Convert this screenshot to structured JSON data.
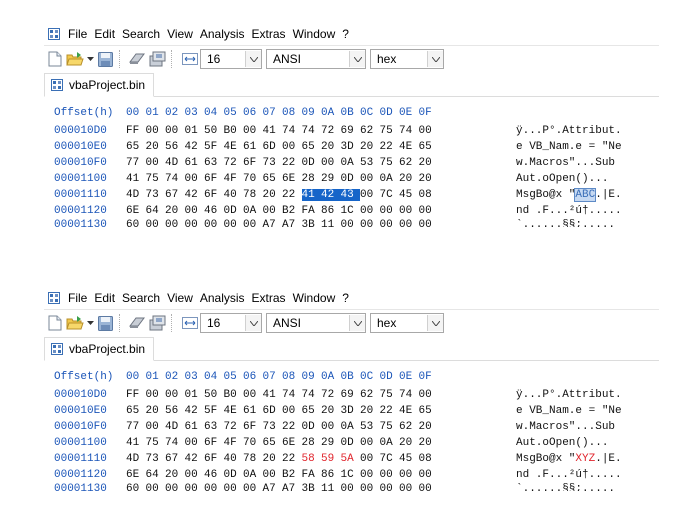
{
  "menu": [
    "File",
    "Edit",
    "Search",
    "View",
    "Analysis",
    "Extras",
    "Window",
    "?"
  ],
  "toolbar": {
    "bytes_per_row": "16",
    "encoding": "ANSI",
    "display_mode": "hex"
  },
  "tab": {
    "label": "vbaProject.bin"
  },
  "hex_header": {
    "offset_label": "Offset(h)",
    "columns": [
      "00",
      "01",
      "02",
      "03",
      "04",
      "05",
      "06",
      "07",
      "08",
      "09",
      "0A",
      "0B",
      "0C",
      "0D",
      "0E",
      "0F"
    ]
  },
  "panels": [
    {
      "rows": [
        {
          "offset": "000010D0",
          "bytes": [
            "FF",
            "00",
            "00",
            "01",
            "50",
            "B0",
            "00",
            "41",
            "74",
            "74",
            "72",
            "69",
            "62",
            "75",
            "74",
            "00"
          ],
          "ascii": "ÿ...P°.Attribut."
        },
        {
          "offset": "000010E0",
          "bytes": [
            "65",
            "20",
            "56",
            "42",
            "5F",
            "4E",
            "61",
            "6D",
            "00",
            "65",
            "20",
            "3D",
            "20",
            "22",
            "4E",
            "65"
          ],
          "ascii": "e VB_Nam.e = \"Ne"
        },
        {
          "offset": "000010F0",
          "bytes": [
            "77",
            "00",
            "4D",
            "61",
            "63",
            "72",
            "6F",
            "73",
            "22",
            "0D",
            "00",
            "0A",
            "53",
            "75",
            "62",
            "20"
          ],
          "ascii": "w.Macros\"...Sub "
        },
        {
          "offset": "00001100",
          "bytes": [
            "41",
            "75",
            "74",
            "00",
            "6F",
            "4F",
            "70",
            "65",
            "6E",
            "28",
            "29",
            "0D",
            "00",
            "0A",
            "20",
            "20"
          ],
          "ascii": "Aut.oOpen()...  "
        },
        {
          "offset": "00001110",
          "bytes": [
            "4D",
            "73",
            "67",
            "42",
            "6F",
            "40",
            "78",
            "20",
            "22",
            "41",
            "42",
            "43",
            "00",
            "7C",
            "45",
            "08"
          ],
          "ascii_pre": "MsgBo@x \"",
          "ascii_mark": "ABC",
          "ascii_post": ".|E."
        },
        {
          "offset": "00001120",
          "bytes": [
            "6E",
            "64",
            "20",
            "00",
            "46",
            "0D",
            "0A",
            "00",
            "B2",
            "FA",
            "86",
            "1C",
            "00",
            "00",
            "00",
            "00"
          ],
          "ascii": "nd .F...²ú†....."
        },
        {
          "offset": "00001130",
          "bytes": [
            "60",
            "00",
            "00",
            "00",
            "00",
            "00",
            "00",
            "A7",
            "A7",
            "3B",
            "11",
            "00",
            "00",
            "00",
            "00",
            "00"
          ],
          "ascii": "`......§§;....."
        }
      ]
    },
    {
      "rows": [
        {
          "offset": "000010D0",
          "bytes": [
            "FF",
            "00",
            "00",
            "01",
            "50",
            "B0",
            "00",
            "41",
            "74",
            "74",
            "72",
            "69",
            "62",
            "75",
            "74",
            "00"
          ],
          "ascii": "ÿ...P°.Attribut."
        },
        {
          "offset": "000010E0",
          "bytes": [
            "65",
            "20",
            "56",
            "42",
            "5F",
            "4E",
            "61",
            "6D",
            "00",
            "65",
            "20",
            "3D",
            "20",
            "22",
            "4E",
            "65"
          ],
          "ascii": "e VB_Nam.e = \"Ne"
        },
        {
          "offset": "000010F0",
          "bytes": [
            "77",
            "00",
            "4D",
            "61",
            "63",
            "72",
            "6F",
            "73",
            "22",
            "0D",
            "00",
            "0A",
            "53",
            "75",
            "62",
            "20"
          ],
          "ascii": "w.Macros\"...Sub "
        },
        {
          "offset": "00001100",
          "bytes": [
            "41",
            "75",
            "74",
            "00",
            "6F",
            "4F",
            "70",
            "65",
            "6E",
            "28",
            "29",
            "0D",
            "00",
            "0A",
            "20",
            "20"
          ],
          "ascii": "Aut.oOpen()...  "
        },
        {
          "offset": "00001110",
          "bytes": [
            "4D",
            "73",
            "67",
            "42",
            "6F",
            "40",
            "78",
            "20",
            "22",
            "58",
            "59",
            "5A",
            "00",
            "7C",
            "45",
            "08"
          ],
          "ascii_pre": "MsgBo@x \"",
          "ascii_mark": "XYZ",
          "ascii_post": ".|E."
        },
        {
          "offset": "00001120",
          "bytes": [
            "6E",
            "64",
            "20",
            "00",
            "46",
            "0D",
            "0A",
            "00",
            "B2",
            "FA",
            "86",
            "1C",
            "00",
            "00",
            "00",
            "00"
          ],
          "ascii": "nd .F...²ú†....."
        },
        {
          "offset": "00001130",
          "bytes": [
            "60",
            "00",
            "00",
            "00",
            "00",
            "00",
            "00",
            "A7",
            "A7",
            "3B",
            "11",
            "00",
            "00",
            "00",
            "00",
            "00"
          ],
          "ascii": "`......§§;....."
        }
      ]
    }
  ],
  "colors": {
    "offset_blue": "#1b55b8",
    "selection_blue": "#1665c9",
    "changed_red": "#e0242c"
  },
  "icons": [
    "app-hex-icon",
    "new-file-icon",
    "open-folder-icon",
    "save-disk-icon",
    "ram-icon",
    "disk-open-icon",
    "column-width-icon",
    "combo-arrow-icon"
  ]
}
